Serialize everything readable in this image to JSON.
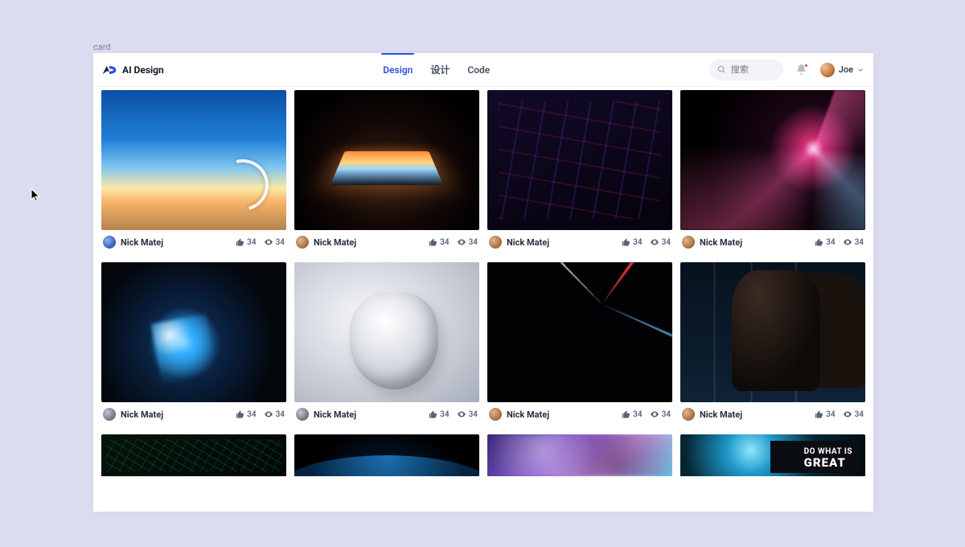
{
  "page_tag": "card",
  "brand": "AI Design",
  "nav": {
    "items": [
      {
        "label": "Design",
        "active": true
      },
      {
        "label": "设计",
        "active": false
      },
      {
        "label": "Code",
        "active": false
      }
    ]
  },
  "search": {
    "placeholder": "搜索"
  },
  "user": {
    "name": "Joe"
  },
  "card_defaults": {
    "author": "Nick Matej",
    "likes": 34,
    "views": 34
  },
  "cards": [
    {
      "author": "Nick Matej",
      "likes": 34,
      "views": 34,
      "thumb": "t-sky",
      "avatar": "v1"
    },
    {
      "author": "Nick Matej",
      "likes": 34,
      "views": 34,
      "thumb": "t-laptop",
      "avatar": "v2"
    },
    {
      "author": "Nick Matej",
      "likes": 34,
      "views": 34,
      "thumb": "t-keyboard",
      "avatar": "v2"
    },
    {
      "author": "Nick Matej",
      "likes": 34,
      "views": 34,
      "thumb": "t-plasma",
      "avatar": "v2"
    },
    {
      "author": "Nick Matej",
      "likes": 34,
      "views": 34,
      "thumb": "t-weld",
      "avatar": "v3"
    },
    {
      "author": "Nick Matej",
      "likes": 34,
      "views": 34,
      "thumb": "t-robothand",
      "avatar": "v3"
    },
    {
      "author": "Nick Matej",
      "likes": 34,
      "views": 34,
      "thumb": "t-lasers",
      "avatar": "v2"
    },
    {
      "author": "Nick Matej",
      "likes": 34,
      "views": 34,
      "thumb": "t-datacenter",
      "avatar": "v2"
    },
    {
      "thumb": "t-circuit"
    },
    {
      "thumb": "t-earth"
    },
    {
      "thumb": "t-abstract"
    },
    {
      "thumb": "t-poster",
      "poster_line1": "DO WHAT IS",
      "poster_line2": "GREAT"
    }
  ],
  "colors": {
    "accent": "#2f4fe8",
    "notif": "#e2445c"
  }
}
